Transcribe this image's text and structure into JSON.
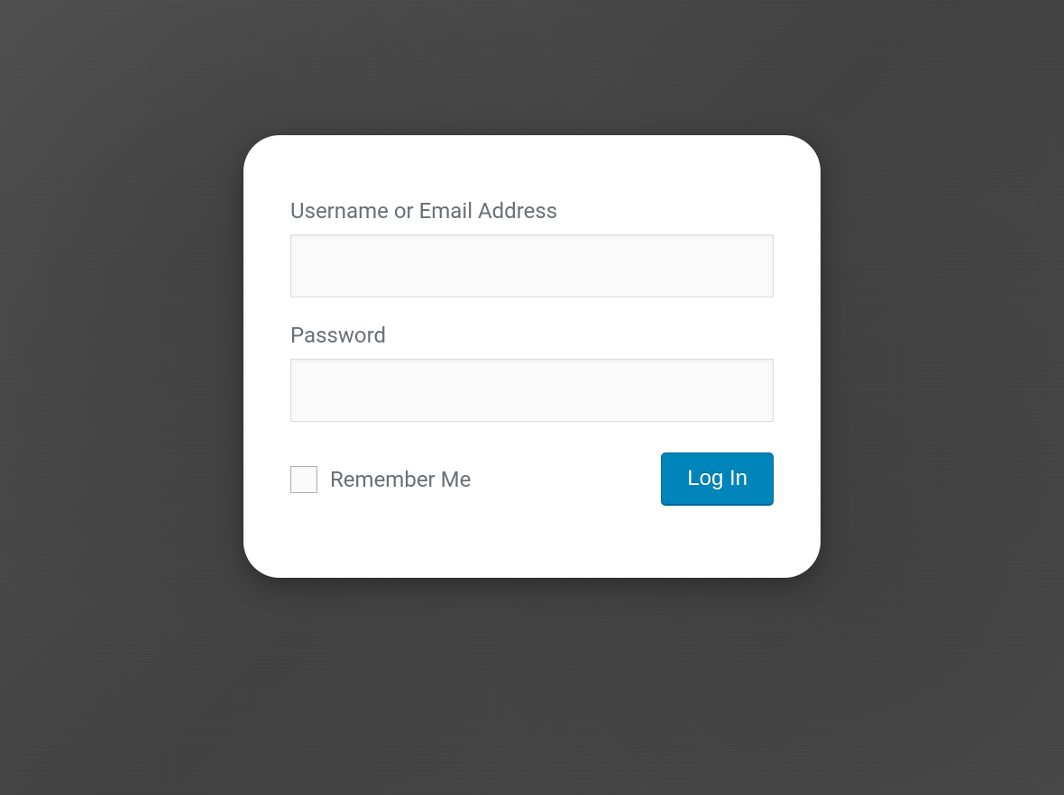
{
  "form": {
    "username_label": "Username or Email Address",
    "username_value": "",
    "password_label": "Password",
    "password_value": "",
    "remember_label": "Remember Me",
    "remember_checked": false,
    "submit_label": "Log In"
  },
  "colors": {
    "button_bg": "#0085ba",
    "button_border": "#006799",
    "label_text": "#6a6f74",
    "input_bg": "#fbfbfb",
    "input_border": "#dcdcdc"
  }
}
